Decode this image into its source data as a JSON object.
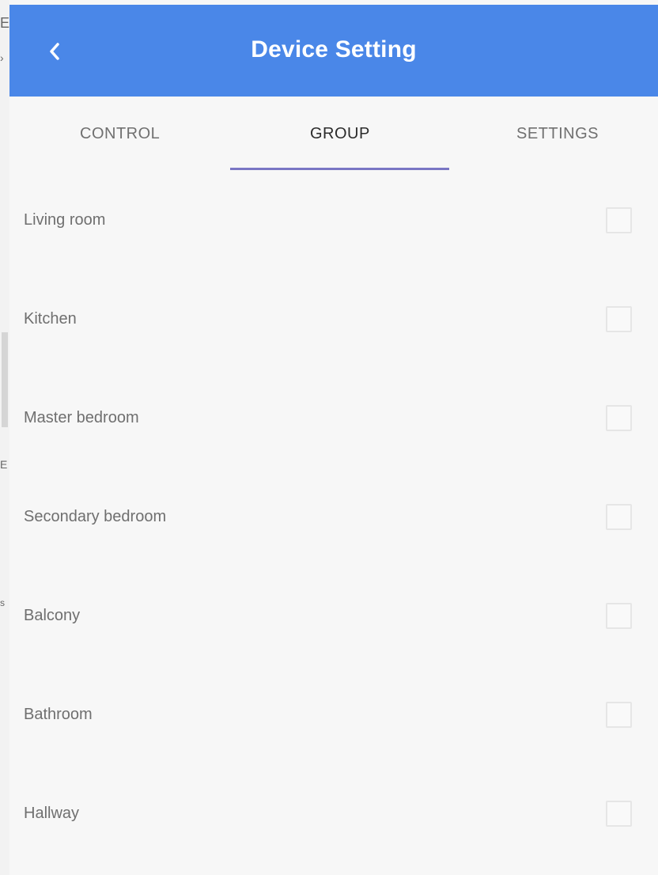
{
  "app_bar": {
    "title": "Device Setting",
    "back_icon": "chevron-left-icon",
    "background": "#4a87e8"
  },
  "tabs": [
    {
      "label": "CONTROL",
      "active": false
    },
    {
      "label": "GROUP",
      "active": true
    },
    {
      "label": "SETTINGS",
      "active": false
    }
  ],
  "accent_color": "#7a76c4",
  "groups": [
    {
      "label": "Living room",
      "checked": false
    },
    {
      "label": "Kitchen",
      "checked": false
    },
    {
      "label": "Master bedroom",
      "checked": false
    },
    {
      "label": "Secondary bedroom",
      "checked": false
    },
    {
      "label": "Balcony",
      "checked": false
    },
    {
      "label": "Bathroom",
      "checked": false
    },
    {
      "label": "Hallway",
      "checked": false
    }
  ]
}
